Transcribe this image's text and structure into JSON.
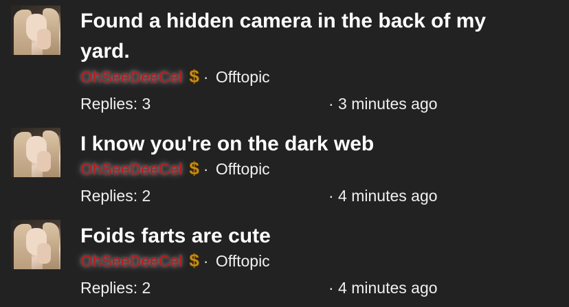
{
  "threads": [
    {
      "title": "Found a hidden camera in the back of my yard.",
      "username": "OhSeeDeeCel",
      "badge_icon": "dollar-icon",
      "separator": "·",
      "section": "Offtopic",
      "replies": "Replies: 3",
      "time": "· 3 minutes ago"
    },
    {
      "title": "I know you're on the dark web",
      "username": "OhSeeDeeCel",
      "badge_icon": "dollar-icon",
      "separator": "·",
      "section": "Offtopic",
      "replies": "Replies: 2",
      "time": "· 4 minutes ago"
    },
    {
      "title": "Foids farts are cute",
      "username": "OhSeeDeeCel",
      "badge_icon": "dollar-icon",
      "separator": "·",
      "section": "Offtopic",
      "replies": "Replies: 2",
      "time": "· 4 minutes ago"
    }
  ],
  "colors": {
    "background": "#222222",
    "username": "#c0161a",
    "badge": "#c98f1a",
    "text": "#ffffff"
  }
}
